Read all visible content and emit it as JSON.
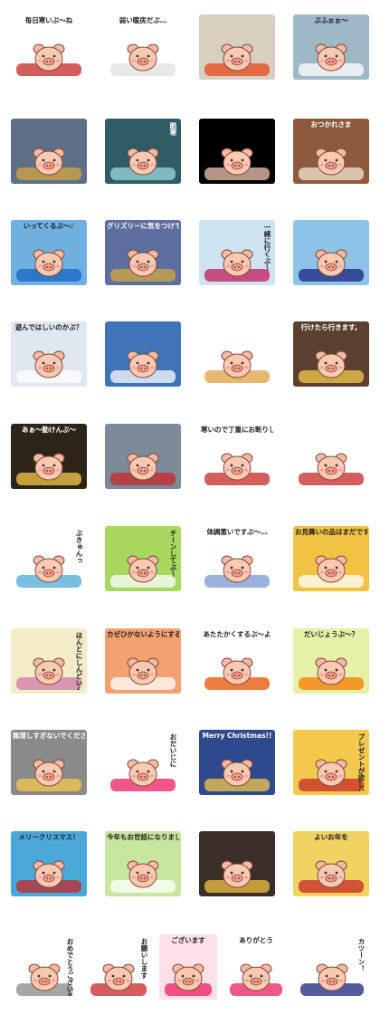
{
  "stickers": [
    {
      "caption": "毎日寒いぶ〜ね",
      "bg": "#ffffff",
      "accent": "#c62828",
      "vertical": false
    },
    {
      "caption": "弱い暖房だぶ…",
      "bg": "#ffffff",
      "accent": "#e0e0e0",
      "vertical": false
    },
    {
      "caption": "",
      "bg": "#d7cfc0",
      "accent": "#e64a19",
      "vertical": false
    },
    {
      "caption": "ぶふぉぉ〜",
      "bg": "#9fb8c8",
      "accent": "#ffffff",
      "vertical": false
    },
    {
      "caption": "",
      "bg": "#5f6f88",
      "accent": "#d4a640",
      "vertical": false
    },
    {
      "caption": "酷寒",
      "bg": "#2e5d66",
      "accent": "#9fd8e0",
      "vertical": true
    },
    {
      "caption": "",
      "bg": "#000000",
      "accent": "#f2c8b0",
      "vertical": false
    },
    {
      "caption": "おつかれさま",
      "bg": "#8c5a3c",
      "accent": "#f6e6d4",
      "vertical": false
    },
    {
      "caption": "いってくるぶ〜♪",
      "bg": "#6fb0e0",
      "accent": "#1565c0",
      "vertical": false
    },
    {
      "caption": "グリズリーに気をつけてね〜",
      "bg": "#5d6fa0",
      "accent": "#d4a640",
      "vertical": false
    },
    {
      "caption": "一緒に行くぶ〜",
      "bg": "#cde4f3",
      "accent": "#c2185b",
      "vertical": true
    },
    {
      "caption": "",
      "bg": "#8ec3e8",
      "accent": "#1a237e",
      "vertical": false
    },
    {
      "caption": "遊んではしいのかぶ？",
      "bg": "#dfe8f0",
      "accent": "#ffffff",
      "vertical": false
    },
    {
      "caption": "",
      "bg": "#3f74b8",
      "accent": "#ffffff",
      "vertical": false
    },
    {
      "caption": "",
      "bg": "#ffffff",
      "accent": "#e0a040",
      "vertical": false
    },
    {
      "caption": "行けたら行きます。",
      "bg": "#5b4030",
      "accent": "#f5c84b",
      "vertical": false
    },
    {
      "caption": "あぁ〜動けんぶ〜",
      "bg": "#2d2418",
      "accent": "#f5c84b",
      "vertical": false
    },
    {
      "caption": "",
      "bg": "#7d8a9a",
      "accent": "#c62828",
      "vertical": false
    },
    {
      "caption": "寒いので丁重にお断りしますぶ。",
      "bg": "#ffffff",
      "accent": "#c62828",
      "vertical": false
    },
    {
      "caption": "",
      "bg": "#ffffff",
      "accent": "#c62828",
      "vertical": false
    },
    {
      "caption": "ぶきゅんっ",
      "bg": "#ffffff",
      "accent": "#4aa8d8",
      "vertical": true
    },
    {
      "caption": "チーンしてぶ〜",
      "bg": "#a8d860",
      "accent": "#ffffff",
      "vertical": true
    },
    {
      "caption": "体調悪いですぶ〜…",
      "bg": "#ffffff",
      "accent": "#7a9ad0",
      "vertical": false
    },
    {
      "caption": "お見舞いの品はまだですかぶ？",
      "bg": "#f2c242",
      "accent": "#ffffff",
      "vertical": false
    },
    {
      "caption": "ほんとにしんどいんぶ〜…ごめんぶ",
      "bg": "#f4ecc8",
      "accent": "#d07aa8",
      "vertical": true
    },
    {
      "caption": "カゼひかないようにするぶ〜よ",
      "bg": "#f4a070",
      "accent": "#ffffff",
      "vertical": false
    },
    {
      "caption": "あたたかくするぶ〜よ",
      "bg": "#ffffff",
      "accent": "#e65100",
      "vertical": false
    },
    {
      "caption": "だいじょうぶ〜？",
      "bg": "#e8f0a8",
      "accent": "#f57c00",
      "vertical": false
    },
    {
      "caption": "無理しすぎないでくださいぶ〜",
      "bg": "#8a8a8a",
      "accent": "#f5c84b",
      "vertical": false
    },
    {
      "caption": "おだいじに",
      "bg": "#ffffff",
      "accent": "#e91e63",
      "vertical": true
    },
    {
      "caption": "Merry Christmas!!",
      "bg": "#2e4a8c",
      "accent": "#f5c84b",
      "vertical": false
    },
    {
      "caption": "プレゼントが欲しいぶ！",
      "bg": "#f2c94c",
      "accent": "#c62828",
      "vertical": true
    },
    {
      "caption": "メリークリスマス！",
      "bg": "#4aa8d8",
      "accent": "#c62828",
      "vertical": false
    },
    {
      "caption": "今年もお世話になりましたぶ〜",
      "bg": "#c8e6a0",
      "accent": "#ffffff",
      "vertical": false
    },
    {
      "caption": "",
      "bg": "#3a2e26",
      "accent": "#f2c242",
      "vertical": false
    },
    {
      "caption": "よいお年を",
      "bg": "#f2d260",
      "accent": "#c62828",
      "vertical": false
    },
    {
      "caption": "おめでとうございます",
      "bg": "#ffffff",
      "accent": "#888888",
      "vertical": true
    },
    {
      "caption": "お願いします",
      "bg": "#ffffff",
      "accent": "#c62828",
      "vertical": true
    },
    {
      "caption": "ございます",
      "bg": "#ffe0e8",
      "accent": "#e91e63",
      "vertical": false
    },
    {
      "caption": "ありがとう",
      "bg": "#ffffff",
      "accent": "#e91e63",
      "vertical": false
    },
    {
      "caption": "カツーン！",
      "bg": "#ffffff",
      "accent": "#1a237e",
      "vertical": true
    }
  ]
}
